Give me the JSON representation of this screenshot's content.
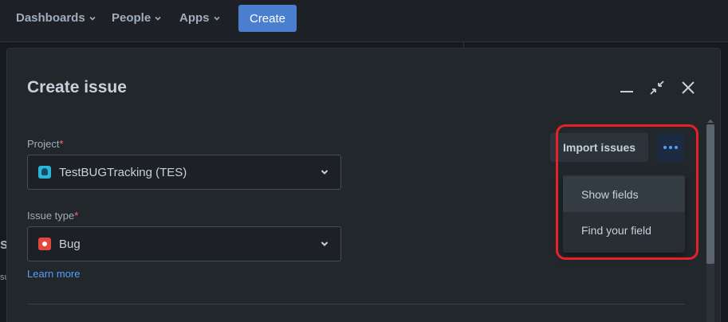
{
  "nav": {
    "items": [
      {
        "label": "Dashboards"
      },
      {
        "label": "People"
      },
      {
        "label": "Apps"
      }
    ],
    "create_label": "Create"
  },
  "background": {
    "partial_heading": "s",
    "partial_text": "su"
  },
  "modal": {
    "title": "Create issue",
    "project": {
      "label": "Project",
      "required": "*",
      "value": "TestBUGTracking (TES)"
    },
    "issue_type": {
      "label": "Issue type",
      "required": "*",
      "value": "Bug"
    },
    "learn_more": "Learn more",
    "import_label": "Import issues",
    "more_menu": {
      "items": [
        {
          "label": "Show fields"
        },
        {
          "label": "Find your field"
        }
      ]
    }
  },
  "colors": {
    "accent": "#579dff",
    "highlight": "#e8202a",
    "required": "#f87168"
  }
}
